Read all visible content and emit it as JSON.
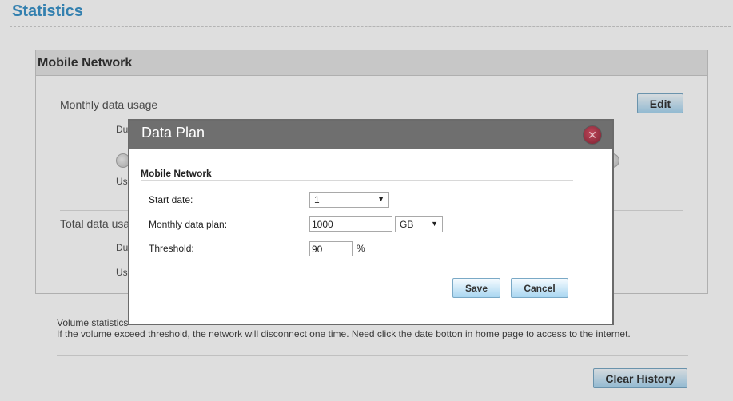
{
  "page": {
    "title": "Statistics"
  },
  "panel": {
    "title": "Mobile Network",
    "monthly_label": "Monthly data usage",
    "monthly_duration_prefix": "Du",
    "monthly_used_prefix": "Us",
    "total_label_partial": "Total data usa",
    "total_duration_prefix": "Du",
    "total_used_prefix": "Us",
    "edit_label": "Edit"
  },
  "notes": {
    "line1_partial": "Volume statistics",
    "line2": "If the volume exceed threshold, the network will disconnect one time. Need click the date botton in home page to access to the internet."
  },
  "clear_history_label": "Clear History",
  "dialog": {
    "title": "Data Plan",
    "close_icon": "close-icon",
    "section_title": "Mobile Network",
    "start_date": {
      "label": "Start date:",
      "value": "1"
    },
    "monthly_plan": {
      "label": "Monthly data plan:",
      "value": "1000",
      "unit_value": "GB"
    },
    "threshold": {
      "label": "Threshold:",
      "value": "90",
      "unit": "%"
    },
    "save_label": "Save",
    "cancel_label": "Cancel"
  },
  "colors": {
    "title": "#3b93c9",
    "dialog_header": "#6f6f6f",
    "button_gradient_bottom": "#a9d6f1"
  }
}
